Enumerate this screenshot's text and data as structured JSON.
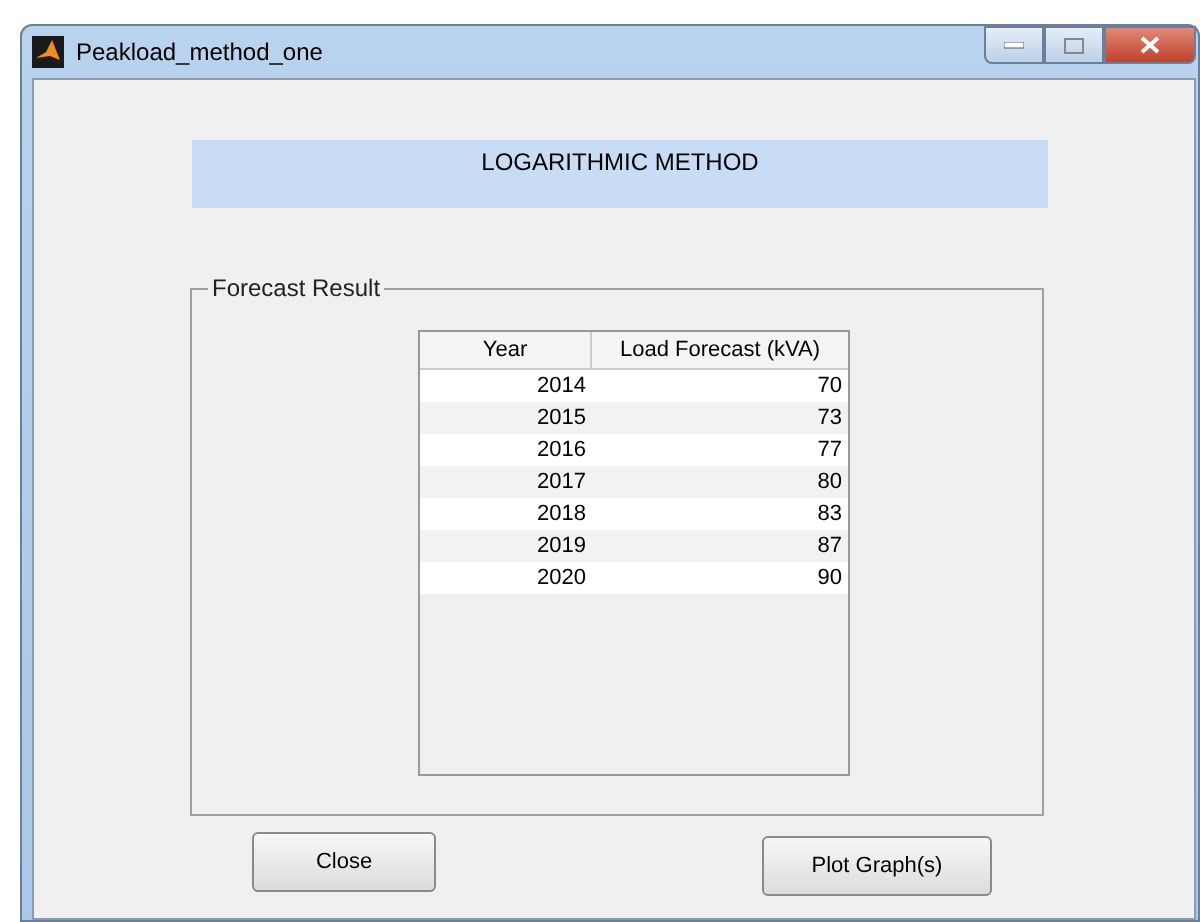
{
  "window": {
    "title": "Peakload_method_one"
  },
  "banner": {
    "text": "LOGARITHMIC METHOD"
  },
  "panel": {
    "title": "Forecast Result",
    "table": {
      "columns": [
        "Year",
        "Load Forecast (kVA)"
      ],
      "rows": [
        [
          "2014",
          "70"
        ],
        [
          "2015",
          "73"
        ],
        [
          "2016",
          "77"
        ],
        [
          "2017",
          "80"
        ],
        [
          "2018",
          "83"
        ],
        [
          "2019",
          "87"
        ],
        [
          "2020",
          "90"
        ]
      ]
    }
  },
  "buttons": [
    {
      "label": "Close"
    },
    {
      "label": "Plot Graph(s)"
    }
  ]
}
